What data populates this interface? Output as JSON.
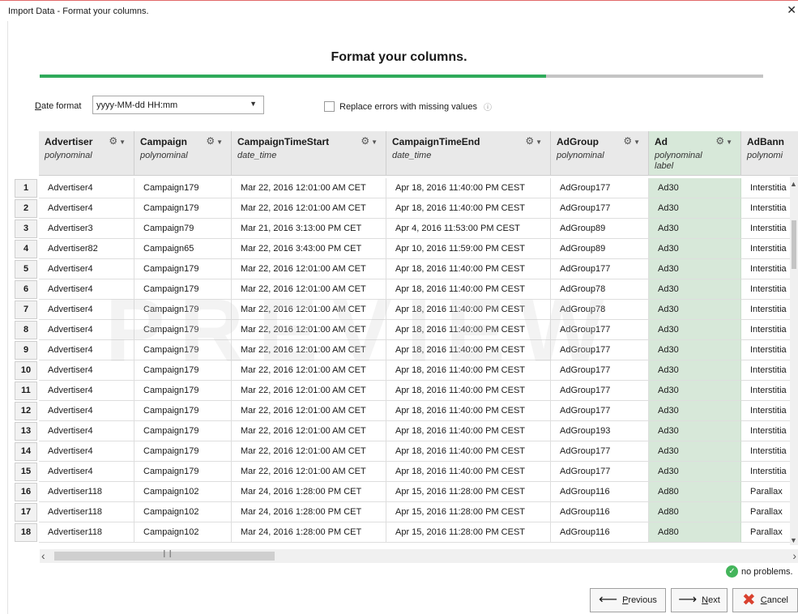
{
  "window": {
    "title": "Import Data - Format your columns.",
    "close_glyph": "✕"
  },
  "heading": "Format your columns.",
  "progress": {
    "fraction": 0.7
  },
  "date_format": {
    "label_prefix": "D",
    "label_rest": "ate format",
    "value": "yyyy-MM-dd HH:mm"
  },
  "replace_errors": {
    "label": "Replace errors with missing values",
    "checked": false
  },
  "columns": [
    {
      "name": "Advertiser",
      "type": "polynominal",
      "role": ""
    },
    {
      "name": "Campaign",
      "type": "polynominal",
      "role": ""
    },
    {
      "name": "CampaignTimeStart",
      "type": "date_time",
      "role": ""
    },
    {
      "name": "CampaignTimeEnd",
      "type": "date_time",
      "role": ""
    },
    {
      "name": "AdGroup",
      "type": "polynominal",
      "role": ""
    },
    {
      "name": "Ad",
      "type": "polynominal",
      "role": "label"
    },
    {
      "name": "AdBann",
      "type": "polynomi",
      "role": ""
    }
  ],
  "rows": [
    {
      "n": "1",
      "cells": [
        "Advertiser4",
        "Campaign179",
        "Mar 22, 2016 12:01:00 AM CET",
        "Apr 18, 2016 11:40:00 PM CEST",
        "AdGroup177",
        "Ad30",
        "Interstitia"
      ]
    },
    {
      "n": "2",
      "cells": [
        "Advertiser4",
        "Campaign179",
        "Mar 22, 2016 12:01:00 AM CET",
        "Apr 18, 2016 11:40:00 PM CEST",
        "AdGroup177",
        "Ad30",
        "Interstitia"
      ]
    },
    {
      "n": "3",
      "cells": [
        "Advertiser3",
        "Campaign79",
        "Mar 21, 2016 3:13:00 PM CET",
        "Apr 4, 2016 11:53:00 PM CEST",
        "AdGroup89",
        "Ad30",
        "Interstitia"
      ]
    },
    {
      "n": "4",
      "cells": [
        "Advertiser82",
        "Campaign65",
        "Mar 22, 2016 3:43:00 PM CET",
        "Apr 10, 2016 11:59:00 PM CEST",
        "AdGroup89",
        "Ad30",
        "Interstitia"
      ]
    },
    {
      "n": "5",
      "cells": [
        "Advertiser4",
        "Campaign179",
        "Mar 22, 2016 12:01:00 AM CET",
        "Apr 18, 2016 11:40:00 PM CEST",
        "AdGroup177",
        "Ad30",
        "Interstitia"
      ]
    },
    {
      "n": "6",
      "cells": [
        "Advertiser4",
        "Campaign179",
        "Mar 22, 2016 12:01:00 AM CET",
        "Apr 18, 2016 11:40:00 PM CEST",
        "AdGroup78",
        "Ad30",
        "Interstitia"
      ]
    },
    {
      "n": "7",
      "cells": [
        "Advertiser4",
        "Campaign179",
        "Mar 22, 2016 12:01:00 AM CET",
        "Apr 18, 2016 11:40:00 PM CEST",
        "AdGroup78",
        "Ad30",
        "Interstitia"
      ]
    },
    {
      "n": "8",
      "cells": [
        "Advertiser4",
        "Campaign179",
        "Mar 22, 2016 12:01:00 AM CET",
        "Apr 18, 2016 11:40:00 PM CEST",
        "AdGroup177",
        "Ad30",
        "Interstitia"
      ]
    },
    {
      "n": "9",
      "cells": [
        "Advertiser4",
        "Campaign179",
        "Mar 22, 2016 12:01:00 AM CET",
        "Apr 18, 2016 11:40:00 PM CEST",
        "AdGroup177",
        "Ad30",
        "Interstitia"
      ]
    },
    {
      "n": "10",
      "cells": [
        "Advertiser4",
        "Campaign179",
        "Mar 22, 2016 12:01:00 AM CET",
        "Apr 18, 2016 11:40:00 PM CEST",
        "AdGroup177",
        "Ad30",
        "Interstitia"
      ]
    },
    {
      "n": "11",
      "cells": [
        "Advertiser4",
        "Campaign179",
        "Mar 22, 2016 12:01:00 AM CET",
        "Apr 18, 2016 11:40:00 PM CEST",
        "AdGroup177",
        "Ad30",
        "Interstitia"
      ]
    },
    {
      "n": "12",
      "cells": [
        "Advertiser4",
        "Campaign179",
        "Mar 22, 2016 12:01:00 AM CET",
        "Apr 18, 2016 11:40:00 PM CEST",
        "AdGroup177",
        "Ad30",
        "Interstitia"
      ]
    },
    {
      "n": "13",
      "cells": [
        "Advertiser4",
        "Campaign179",
        "Mar 22, 2016 12:01:00 AM CET",
        "Apr 18, 2016 11:40:00 PM CEST",
        "AdGroup193",
        "Ad30",
        "Interstitia"
      ]
    },
    {
      "n": "14",
      "cells": [
        "Advertiser4",
        "Campaign179",
        "Mar 22, 2016 12:01:00 AM CET",
        "Apr 18, 2016 11:40:00 PM CEST",
        "AdGroup177",
        "Ad30",
        "Interstitia"
      ]
    },
    {
      "n": "15",
      "cells": [
        "Advertiser4",
        "Campaign179",
        "Mar 22, 2016 12:01:00 AM CET",
        "Apr 18, 2016 11:40:00 PM CEST",
        "AdGroup177",
        "Ad30",
        "Interstitia"
      ]
    },
    {
      "n": "16",
      "cells": [
        "Advertiser118",
        "Campaign102",
        "Mar 24, 2016 1:28:00 PM CET",
        "Apr 15, 2016 11:28:00 PM CEST",
        "AdGroup116",
        "Ad80",
        "Parallax"
      ]
    },
    {
      "n": "17",
      "cells": [
        "Advertiser118",
        "Campaign102",
        "Mar 24, 2016 1:28:00 PM CET",
        "Apr 15, 2016 11:28:00 PM CEST",
        "AdGroup116",
        "Ad80",
        "Parallax"
      ]
    },
    {
      "n": "18",
      "cells": [
        "Advertiser118",
        "Campaign102",
        "Mar 24, 2016 1:28:00 PM CET",
        "Apr 15, 2016 11:28:00 PM CEST",
        "AdGroup116",
        "Ad80",
        "Parallax"
      ]
    }
  ],
  "status": {
    "text": "no problems.",
    "icon": "check-circle-icon"
  },
  "buttons": {
    "previous": {
      "prefix": "P",
      "rest": "revious"
    },
    "next": {
      "prefix": "N",
      "rest": "ext"
    },
    "cancel": {
      "prefix": "C",
      "rest": "ancel"
    }
  },
  "colors": {
    "accent": "#2faa5a",
    "label_column": "#d7e8d9",
    "cancel_red": "#d9412f"
  },
  "watermark": "PREVIEW"
}
